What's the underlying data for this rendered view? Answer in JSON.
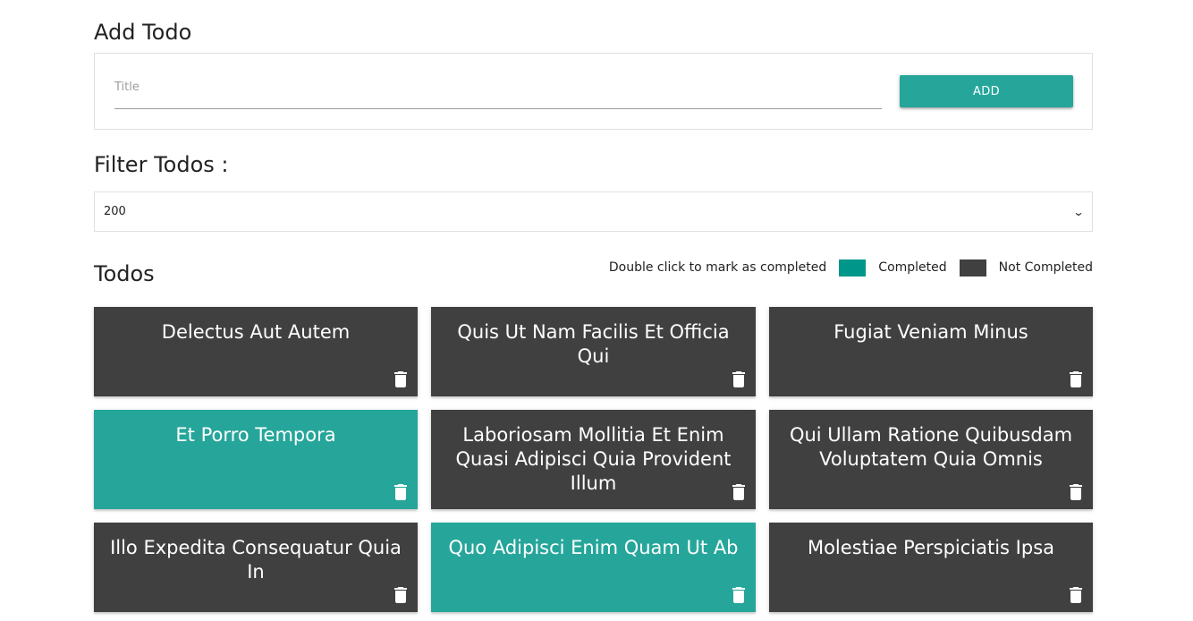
{
  "add_section": {
    "heading": "Add Todo",
    "title_placeholder": "Title",
    "title_value": "",
    "add_button_label": "ADD"
  },
  "filter_section": {
    "heading": "Filter Todos :",
    "selected_value": "200"
  },
  "todos_section": {
    "heading": "Todos",
    "legend": {
      "hint": "Double click to mark as completed",
      "completed_label": "Completed",
      "not_completed_label": "Not Completed",
      "completed_color": "#00968a",
      "not_completed_color": "#404040"
    },
    "items": [
      {
        "title": "Delectus Aut Autem",
        "completed": false
      },
      {
        "title": "Quis Ut Nam Facilis Et Officia Qui",
        "completed": false
      },
      {
        "title": "Fugiat Veniam Minus",
        "completed": false
      },
      {
        "title": "Et Porro Tempora",
        "completed": true
      },
      {
        "title": "Laboriosam Mollitia Et Enim Quasi Adipisci Quia Provident Illum",
        "completed": false
      },
      {
        "title": "Qui Ullam Ratione Quibusdam Voluptatem Quia Omnis",
        "completed": false
      },
      {
        "title": "Illo Expedita Consequatur Quia In",
        "completed": false
      },
      {
        "title": "Quo Adipisci Enim Quam Ut Ab",
        "completed": true
      },
      {
        "title": "Molestiae Perspiciatis Ipsa",
        "completed": false
      }
    ],
    "item_icon": "trash-icon"
  },
  "colors": {
    "accent": "#26a69a",
    "card_dark": "#404040"
  }
}
